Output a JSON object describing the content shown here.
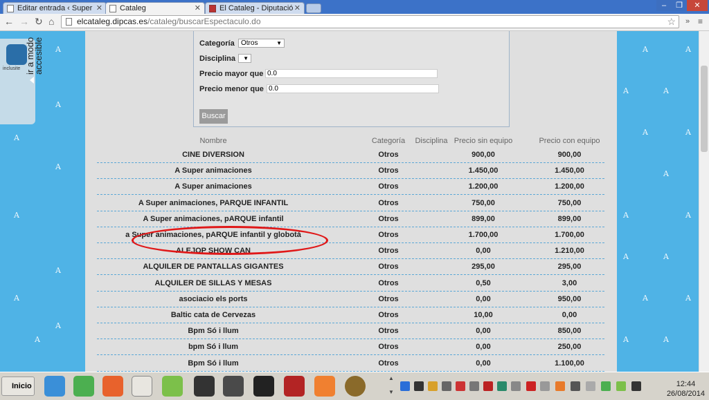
{
  "browser": {
    "tabs": [
      {
        "label": "Editar entrada ‹ Super",
        "active": false
      },
      {
        "label": "Cataleg",
        "active": true
      },
      {
        "label": "El Cataleg - Diputació",
        "active": false
      }
    ],
    "address": {
      "domain": "elcataleg.dipcas.es",
      "path": "/cataleg/buscarEspectaculo.do"
    }
  },
  "accessibility": {
    "brand": "inclusite",
    "label_line1": "ir a modo",
    "label_line2": "accesible"
  },
  "form": {
    "categoria_label": "Categoría",
    "categoria_value": "Otros",
    "disciplina_label": "Disciplina",
    "disciplina_value": "",
    "precio_mayor_label": "Precio mayor que",
    "precio_mayor_value": "0.0",
    "precio_menor_label": "Precio menor que",
    "precio_menor_value": "0.0",
    "buscar_label": "Buscar"
  },
  "table": {
    "headers": {
      "nombre": "Nombre",
      "categoria": "Categoría",
      "disciplina": "Disciplina",
      "precio_sin": "Precio sin equipo",
      "precio_con": "Precio con equipo"
    },
    "rows": [
      {
        "nombre": "CINE DIVERSION",
        "categoria": "Otros",
        "precio_sin": "900,00",
        "precio_con": "900,00"
      },
      {
        "nombre": "A Super animaciones",
        "categoria": "Otros",
        "precio_sin": "1.450,00",
        "precio_con": "1.450,00"
      },
      {
        "nombre": "A Super animaciones",
        "categoria": "Otros",
        "precio_sin": "1.200,00",
        "precio_con": "1.200,00"
      },
      {
        "nombre": "A Super animaciones, PARQUE INFANTIL",
        "categoria": "Otros",
        "precio_sin": "750,00",
        "precio_con": "750,00"
      },
      {
        "nombre": "A Super animaciones, pARQUE infantil",
        "categoria": "Otros",
        "precio_sin": "899,00",
        "precio_con": "899,00"
      },
      {
        "nombre": "a Super animaciones, pARQUE infantil y globotá",
        "categoria": "Otros",
        "precio_sin": "1.700,00",
        "precio_con": "1.700,00"
      },
      {
        "nombre": "ALEJOP SHOW CAN",
        "categoria": "Otros",
        "precio_sin": "0,00",
        "precio_con": "1.210,00"
      },
      {
        "nombre": "ALQUILER DE PANTALLAS GIGANTES",
        "categoria": "Otros",
        "precio_sin": "295,00",
        "precio_con": "295,00"
      },
      {
        "nombre": "ALQUILER DE SILLAS Y MESAS",
        "categoria": "Otros",
        "precio_sin": "0,50",
        "precio_con": "3,00"
      },
      {
        "nombre": "asociacio els ports",
        "categoria": "Otros",
        "precio_sin": "0,00",
        "precio_con": "950,00"
      },
      {
        "nombre": "Baltic cata de Cervezas",
        "categoria": "Otros",
        "precio_sin": "10,00",
        "precio_con": "0,00"
      },
      {
        "nombre": "Bpm Só i llum",
        "categoria": "Otros",
        "precio_sin": "0,00",
        "precio_con": "850,00"
      },
      {
        "nombre": "bpm Só i llum",
        "categoria": "Otros",
        "precio_sin": "0,00",
        "precio_con": "250,00"
      },
      {
        "nombre": "Bpm Só i llum",
        "categoria": "Otros",
        "precio_sin": "0,00",
        "precio_con": "1.100,00"
      }
    ]
  },
  "taskbar": {
    "start_label": "Inicio",
    "time": "12:44",
    "date": "26/08/2014"
  }
}
